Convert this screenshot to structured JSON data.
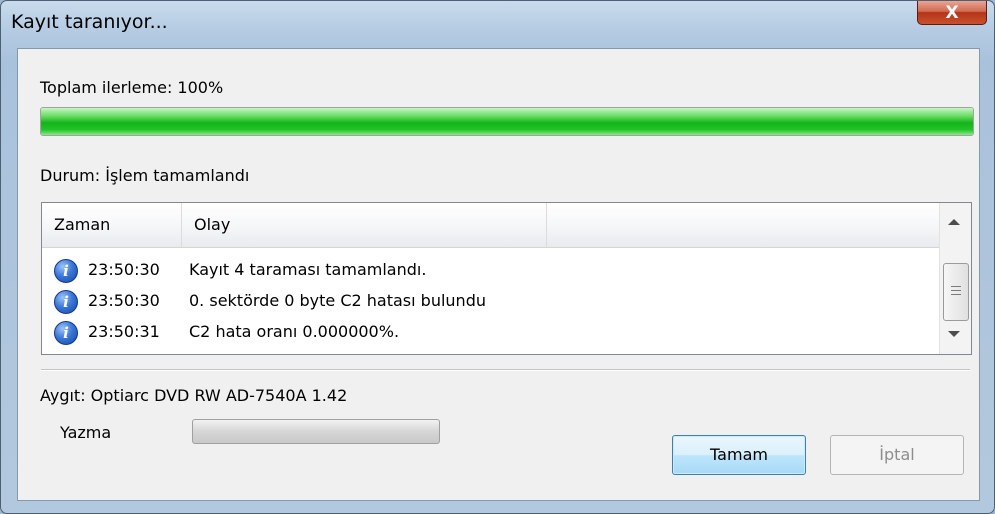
{
  "window": {
    "title": "Kayıt taranıyor...",
    "close_glyph": "X"
  },
  "overall": {
    "label": "Toplam ilerleme: 100%",
    "progress_percent": 100
  },
  "status": {
    "label": "Durum: İşlem tamamlandı"
  },
  "log": {
    "columns": [
      "Zaman",
      "Olay"
    ],
    "rows": [
      {
        "icon": "info-icon",
        "time": "23:50:30",
        "event": "Kayıt 4 taraması tamamlandı."
      },
      {
        "icon": "info-icon",
        "time": "23:50:30",
        "event": "0. sektörde 0 byte C2 hatası bulundu"
      },
      {
        "icon": "info-icon",
        "time": "23:50:31",
        "event": "C2 hata oranı 0.000000%."
      }
    ]
  },
  "device": {
    "label": "Aygıt: Optiarc DVD RW AD-7540A 1.42",
    "write_label": "Yazma",
    "write_progress_percent": 0
  },
  "buttons": {
    "ok": "Tamam",
    "cancel": "İptal"
  },
  "colors": {
    "progress_green": "#13b41a",
    "close_red": "#c9512e"
  }
}
